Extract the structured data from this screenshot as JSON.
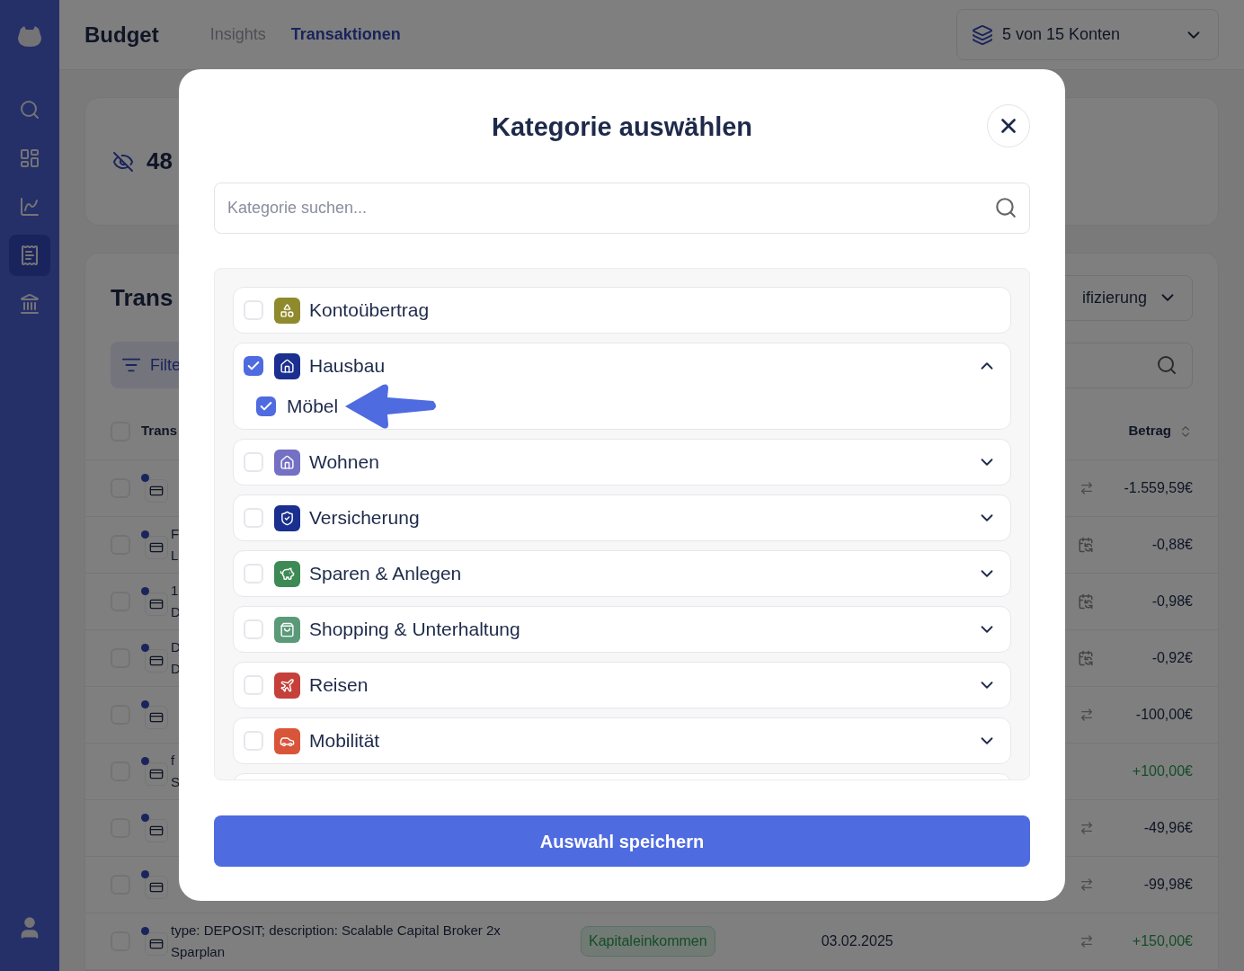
{
  "sidebar": {
    "items": [
      {
        "kind": "search",
        "selected": false
      },
      {
        "kind": "dashboard",
        "selected": false
      },
      {
        "kind": "chart",
        "selected": false
      },
      {
        "kind": "receipt",
        "selected": true
      },
      {
        "kind": "bank",
        "selected": false
      }
    ]
  },
  "header": {
    "title": "Budget",
    "tabs": [
      {
        "label": "Insights",
        "selected": false
      },
      {
        "label": "Transaktionen",
        "selected": true
      }
    ],
    "accounts": "5 von 15 Konten"
  },
  "summary": {
    "value": "48"
  },
  "transactions": {
    "title": "Trans",
    "filter": "Filte",
    "grouping": "ifizierung",
    "columns": [
      "Trans",
      "Betrag"
    ],
    "all_checked": false,
    "rows": [
      {
        "kind": "transfer",
        "checked": false,
        "lines": [],
        "amount": "-1.559,59€",
        "income": false
      },
      {
        "kind": "recurring",
        "checked": false,
        "lines": [
          "F",
          "L"
        ],
        "amount": "-0,88€",
        "income": false
      },
      {
        "kind": "recurring",
        "checked": false,
        "lines": [
          "1",
          "D"
        ],
        "amount": "-0,98€",
        "income": false
      },
      {
        "kind": "recurring",
        "checked": false,
        "lines": [
          "D",
          "D"
        ],
        "amount": "-0,92€",
        "income": false
      },
      {
        "kind": "transfer",
        "checked": false,
        "lines": [],
        "amount": "-100,00€",
        "income": false
      },
      {
        "kind": "plain",
        "checked": false,
        "lines": [
          "f",
          "S"
        ],
        "amount": "+100,00€",
        "income": true
      },
      {
        "kind": "transfer",
        "checked": false,
        "lines": [],
        "amount": "-49,96€",
        "income": false
      },
      {
        "kind": "transfer",
        "checked": false,
        "lines": [],
        "amount": "-99,98€",
        "income": false
      },
      {
        "kind": "transfer",
        "checked": false,
        "lines": [
          "type: DEPOSIT; description: Scalable Capital Broker 2x Sparplan"
        ],
        "tag": "Kapitaleinkommen",
        "date": "03.02.2025",
        "amount": "+150,00€",
        "income": true
      }
    ]
  },
  "modal": {
    "title": "Kategorie auswählen",
    "search": {
      "placeholder": "Kategorie suchen..."
    },
    "categories": [
      {
        "label": "Kontoübertrag",
        "kind": "shapes",
        "color": "#8f8a2c",
        "checked": false
      },
      {
        "label": "Hausbau",
        "kind": "house",
        "color": "#1a2f8f",
        "checked": true,
        "expanded": true,
        "children": [
          {
            "label": "Möbel",
            "checked": true,
            "highlighted": true
          }
        ]
      },
      {
        "label": "Wohnen",
        "kind": "home",
        "color": "#7470c4",
        "checked": false,
        "expanded": false
      },
      {
        "label": "Versicherung",
        "kind": "shield",
        "color": "#1a2f8f",
        "checked": false,
        "expanded": false
      },
      {
        "label": "Sparen & Anlegen",
        "kind": "piggy",
        "color": "#3d8a55",
        "checked": false,
        "expanded": false
      },
      {
        "label": "Shopping & Unterhaltung",
        "kind": "bag",
        "color": "#5a9a78",
        "checked": false,
        "expanded": false
      },
      {
        "label": "Reisen",
        "kind": "plane",
        "color": "#c5403a",
        "checked": false,
        "expanded": false
      },
      {
        "label": "Mobilität",
        "kind": "car",
        "color": "#d9553a",
        "checked": false,
        "expanded": false
      }
    ],
    "save": "Auswahl speichern"
  }
}
